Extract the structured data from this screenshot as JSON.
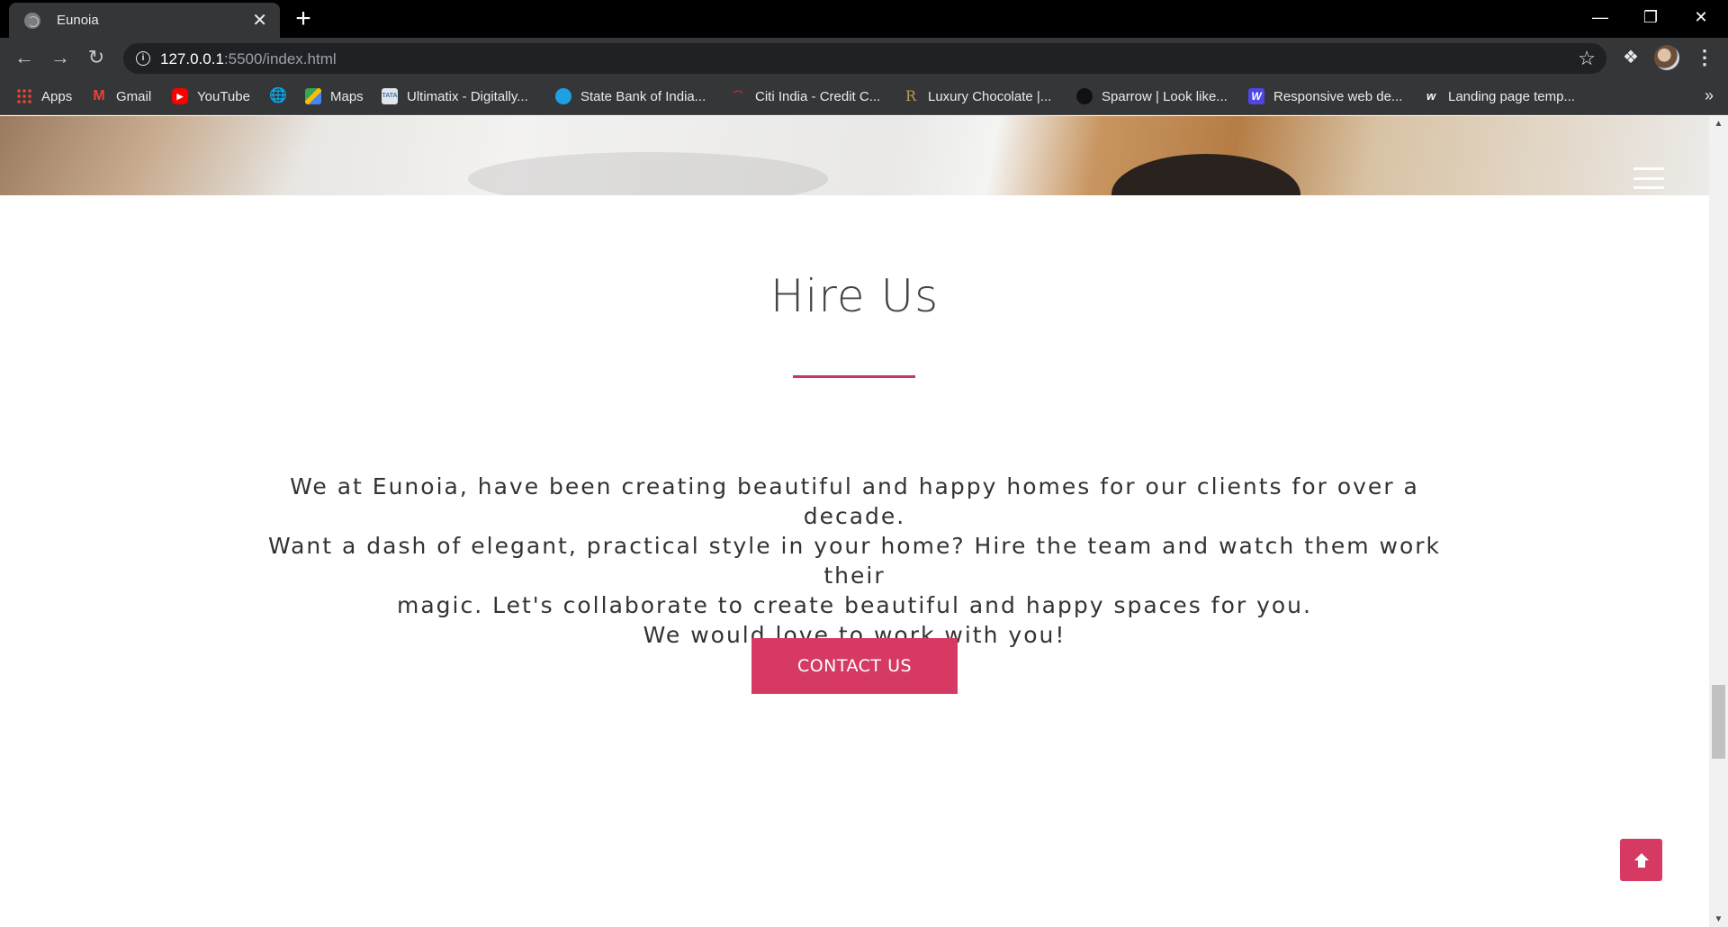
{
  "browser": {
    "tab_title": "Eunoia",
    "url_host": "127.0.0.1",
    "url_path": ":5500/index.html",
    "bookmarks": [
      {
        "label": "Apps",
        "icon": "apps-grid-icon",
        "color": "#ea4335"
      },
      {
        "label": "Gmail",
        "icon": "gmail-icon",
        "color": "#ea4335"
      },
      {
        "label": "YouTube",
        "icon": "youtube-icon",
        "color": "#ff0000"
      },
      {
        "label": "",
        "icon": "globe-icon",
        "color": "#e8eaed"
      },
      {
        "label": "Maps",
        "icon": "maps-icon",
        "color": "#34a853"
      },
      {
        "label": "Ultimatix - Digitally...",
        "icon": "tata-icon",
        "color": "#4a6fa5"
      },
      {
        "label": "State Bank of India...",
        "icon": "sbi-icon",
        "color": "#1fa0e3"
      },
      {
        "label": "Citi India - Credit C...",
        "icon": "citi-icon",
        "color": "#003b70"
      },
      {
        "label": "Luxury Chocolate |...",
        "icon": "r-icon",
        "color": "#b9995a"
      },
      {
        "label": "Sparrow | Look like...",
        "icon": "sparrow-icon",
        "color": "#111111"
      },
      {
        "label": "Responsive web de...",
        "icon": "w-icon",
        "color": "#4f46e5"
      },
      {
        "label": "Landing page temp...",
        "icon": "w-small-icon",
        "color": "#353638"
      }
    ]
  },
  "page": {
    "title": "Hire Us",
    "paragraph_lines": [
      "We at Eunoia, have been creating beautiful and happy homes for our clients for over a decade.",
      "Want a dash of elegant, practical style in your home? Hire the team and watch them work their",
      "magic. Let's collaborate to create beautiful and happy spaces for you.",
      "We would love to work with you!"
    ],
    "contact_label": "CONTACT US"
  },
  "colors": {
    "accent": "#d63a63",
    "underline": "#c8375f",
    "heading": "#444444",
    "body_text": "#333333",
    "chrome_dark": "#353638"
  }
}
